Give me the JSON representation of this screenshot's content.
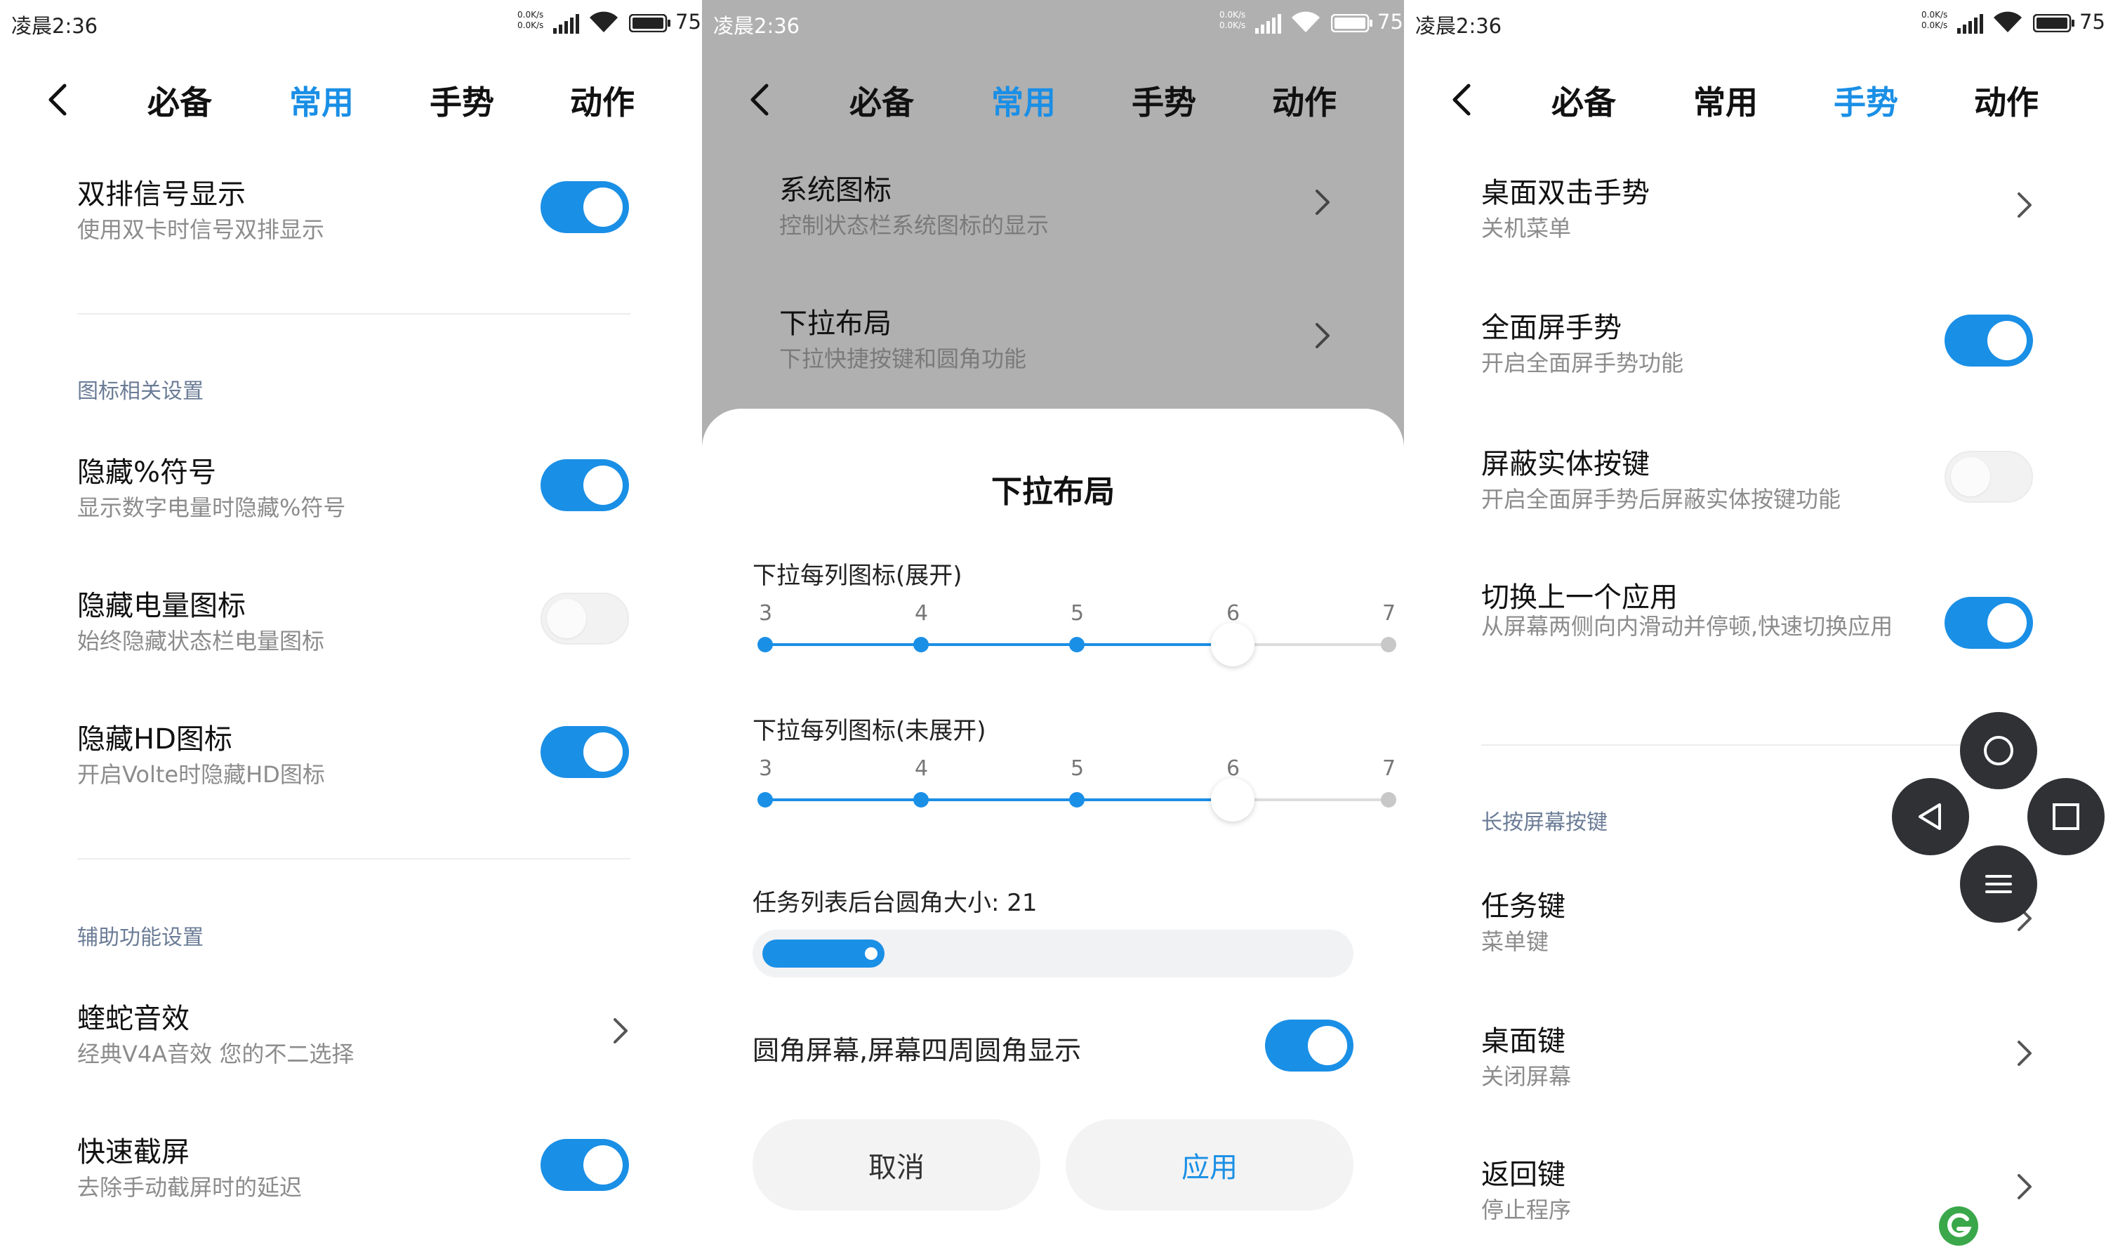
{
  "status": {
    "time": "凌晨2:36",
    "speed_up": "0.0K/s",
    "speed_down": "0.0K/s",
    "battery": "75"
  },
  "tabs": [
    "必备",
    "常用",
    "手势",
    "动作"
  ],
  "colors": {
    "accent": "#1a8fe6",
    "dim": "#b0b0b0"
  },
  "panel1": {
    "active_tab": 1,
    "items": [
      {
        "title": "双排信号显示",
        "subtitle": "使用双卡时信号双排显示",
        "control": "toggle",
        "on": true
      },
      {
        "section": "图标相关设置"
      },
      {
        "title": "隐藏%符号",
        "subtitle": "显示数字电量时隐藏%符号",
        "control": "toggle",
        "on": true
      },
      {
        "title": "隐藏电量图标",
        "subtitle": "始终隐藏状态栏电量图标",
        "control": "toggle",
        "on": false
      },
      {
        "title": "隐藏HD图标",
        "subtitle": "开启Volte时隐藏HD图标",
        "control": "toggle",
        "on": true
      },
      {
        "section": "辅助功能设置"
      },
      {
        "title": "蝰蛇音效",
        "subtitle": "经典V4A音效 您的不二选择",
        "control": "chevron"
      },
      {
        "title": "快速截屏",
        "subtitle": "去除手动截屏时的延迟",
        "control": "toggle",
        "on": true
      }
    ]
  },
  "panel2": {
    "active_tab": 1,
    "items": [
      {
        "title": "系统图标",
        "subtitle": "控制状态栏系统图标的显示",
        "control": "chevron"
      },
      {
        "title": "下拉布局",
        "subtitle": "下拉快捷按键和圆角功能",
        "control": "chevron"
      }
    ],
    "dialog": {
      "title": "下拉布局",
      "slider1": {
        "label": "下拉每列图标(展开)",
        "ticks": [
          "3",
          "4",
          "5",
          "6",
          "7"
        ],
        "value": 6
      },
      "slider2": {
        "label": "下拉每列图标(未展开)",
        "ticks": [
          "3",
          "4",
          "5",
          "6",
          "7"
        ],
        "value": 6
      },
      "corner": {
        "label": "任务列表后台圆角大小: 21",
        "value": 21
      },
      "round_screen": {
        "label": "圆角屏幕,屏幕四周圆角显示",
        "on": true
      },
      "cancel": "取消",
      "apply": "应用"
    }
  },
  "panel3": {
    "active_tab": 2,
    "items": [
      {
        "title": "桌面双击手势",
        "subtitle": "关机菜单",
        "control": "chevron"
      },
      {
        "title": "全面屏手势",
        "subtitle": "开启全面屏手势功能",
        "control": "toggle",
        "on": true
      },
      {
        "title": "屏蔽实体按键",
        "subtitle": "开启全面屏手势后屏蔽实体按键功能",
        "control": "toggle",
        "on": false
      },
      {
        "title": "切换上一个应用",
        "subtitle": "从屏幕两侧向内滑动并停顿,快速切换应用",
        "control": "toggle",
        "on": true
      },
      {
        "section": "长按屏幕按键"
      },
      {
        "title": "任务键",
        "subtitle": "菜单键",
        "control": "chevron"
      },
      {
        "title": "桌面键",
        "subtitle": "关闭屏幕",
        "control": "chevron"
      },
      {
        "title": "返回键",
        "subtitle": "停止程序",
        "control": "chevron"
      }
    ],
    "floating_nav": [
      "home-circle",
      "back-triangle",
      "recents-square",
      "menu-lines"
    ]
  }
}
